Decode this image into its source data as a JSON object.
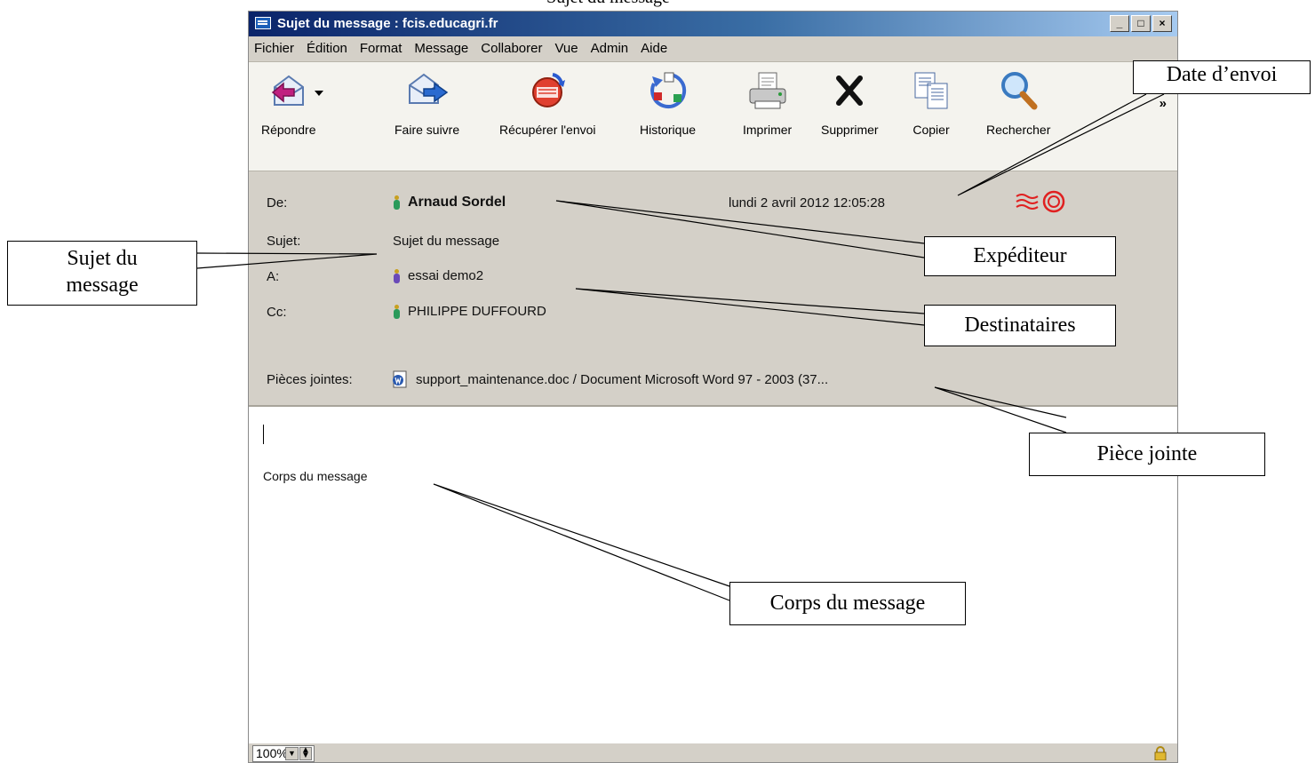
{
  "caption": "Sujet du message",
  "window": {
    "title": "Sujet du message : fcis.educagri.fr",
    "controls": [
      "_",
      "□",
      "×"
    ]
  },
  "menu": [
    "Fichier",
    "Édition",
    "Format",
    "Message",
    "Collaborer",
    "Vue",
    "Admin",
    "Aide"
  ],
  "toolbar": {
    "reply": "Répondre",
    "forward": "Faire suivre",
    "retract": "Récupérer l'envoi",
    "history": "Historique",
    "print": "Imprimer",
    "delete": "Supprimer",
    "copy": "Copier",
    "search": "Rechercher",
    "more": "»"
  },
  "header": {
    "from_label": "De:",
    "from_value": "Arnaud Sordel",
    "date": "lundi 2 avril 2012 12:05:28",
    "subject_label": "Sujet:",
    "subject_value": "Sujet du message",
    "to_label": "A:",
    "to_value": "essai demo2",
    "cc_label": "Cc:",
    "cc_value": "PHILIPPE DUFFOURD",
    "attachments_label": "Pièces jointes:",
    "attachment_value": "support_maintenance.doc / Document Microsoft Word 97 - 2003 (37..."
  },
  "body": {
    "text": "Corps du message"
  },
  "statusbar": {
    "zoom": "100%"
  },
  "annotations": {
    "date": "Date d’envoi",
    "sender": "Expéditeur",
    "subject_line1": "Sujet du",
    "subject_line2": "message",
    "recipients": "Destinataires",
    "attachment": "Pièce jointe",
    "body": "Corps du message"
  }
}
